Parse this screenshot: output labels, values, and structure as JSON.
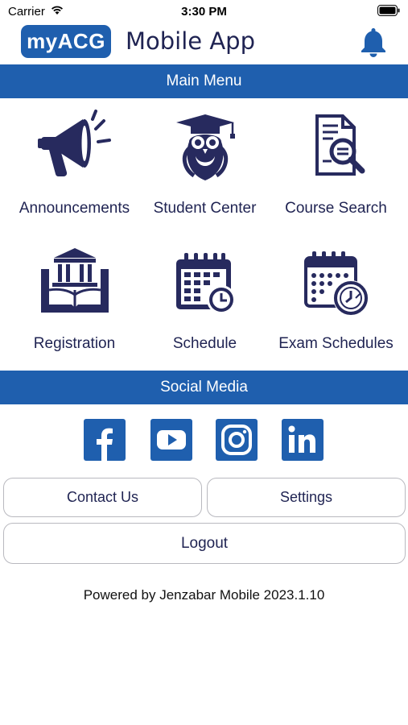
{
  "status_bar": {
    "carrier": "Carrier",
    "time": "3:30 PM"
  },
  "header": {
    "logo_text": "myACG",
    "title": "Mobile App",
    "brand_color": "#1f5fae",
    "notification_icon": "bell-icon"
  },
  "main_menu": {
    "title": "Main Menu",
    "items": [
      {
        "label": "Announcements",
        "icon": "megaphone-icon"
      },
      {
        "label": "Student Center",
        "icon": "owl-graduate-icon"
      },
      {
        "label": "Course Search",
        "icon": "document-search-icon"
      },
      {
        "label": "Registration",
        "icon": "building-book-icon"
      },
      {
        "label": "Schedule",
        "icon": "calendar-clock-icon"
      },
      {
        "label": "Exam Schedules",
        "icon": "calendar-alarm-icon"
      }
    ]
  },
  "social_media": {
    "title": "Social Media",
    "items": [
      {
        "name": "Facebook",
        "icon": "facebook-icon"
      },
      {
        "name": "YouTube",
        "icon": "youtube-icon"
      },
      {
        "name": "Instagram",
        "icon": "instagram-icon"
      },
      {
        "name": "LinkedIn",
        "icon": "linkedin-icon"
      }
    ]
  },
  "buttons": {
    "contact": "Contact Us",
    "settings": "Settings",
    "logout": "Logout"
  },
  "footer": {
    "powered_by": "Powered by Jenzabar Mobile 2023.1.10"
  }
}
